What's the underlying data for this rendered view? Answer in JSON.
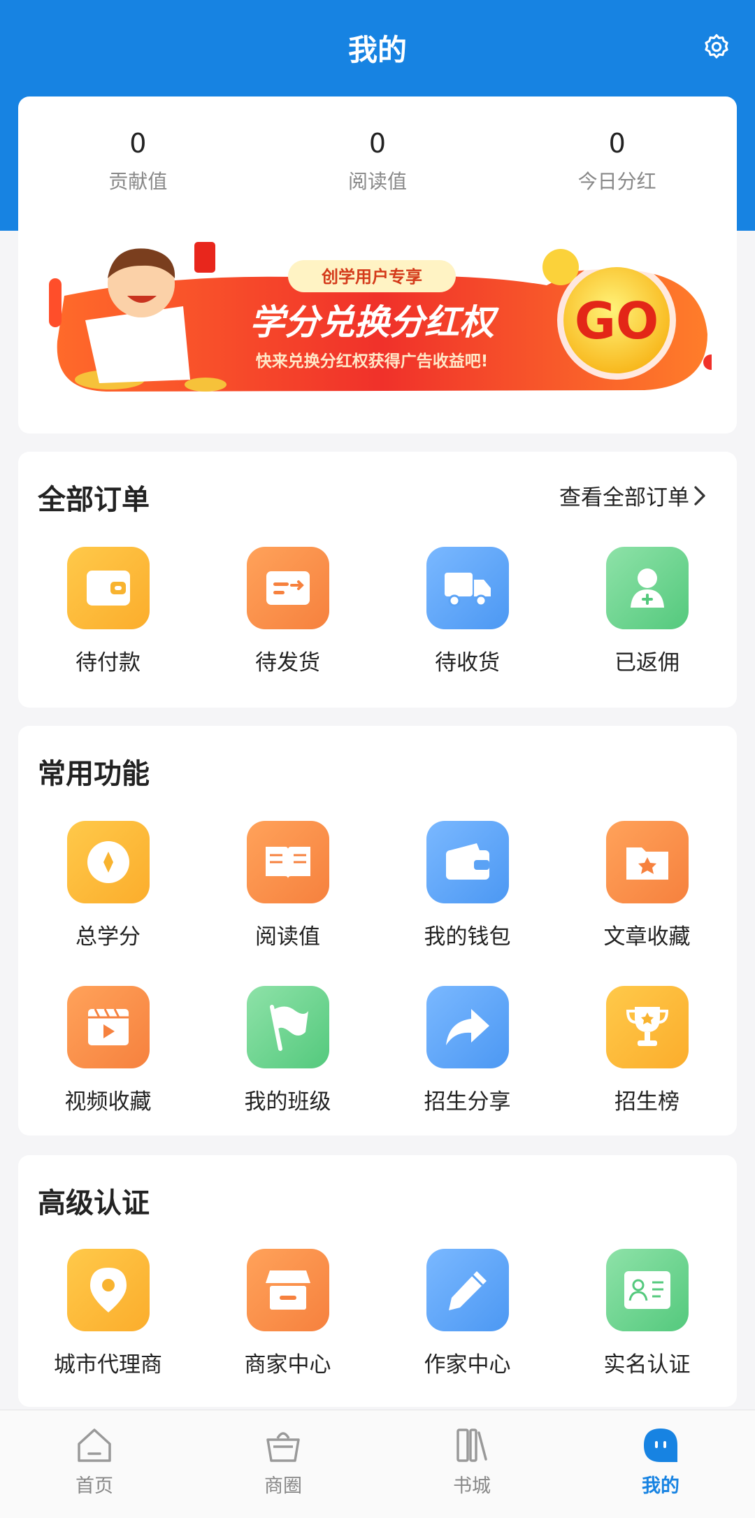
{
  "header": {
    "title": "我的"
  },
  "stats": [
    {
      "value": "0",
      "label": "贡献值"
    },
    {
      "value": "0",
      "label": "阅读值"
    },
    {
      "value": "0",
      "label": "今日分红"
    }
  ],
  "banner": {
    "tag": "创学用户专享",
    "title": "学分兑换分红权",
    "subtitle": "快来兑换分红权获得广告收益吧!",
    "cta": "GO"
  },
  "orders": {
    "title": "全部订单",
    "more": "查看全部订单",
    "items": [
      {
        "label": "待付款",
        "icon": "wallet-icon"
      },
      {
        "label": "待发货",
        "icon": "shipping-card-icon"
      },
      {
        "label": "待收货",
        "icon": "truck-icon"
      },
      {
        "label": "已返佣",
        "icon": "user-plus-icon"
      }
    ]
  },
  "common": {
    "title": "常用功能",
    "items": [
      {
        "label": "总学分",
        "icon": "coin-icon"
      },
      {
        "label": "阅读值",
        "icon": "book-icon"
      },
      {
        "label": "我的钱包",
        "icon": "wallet-icon"
      },
      {
        "label": "文章收藏",
        "icon": "folder-star-icon"
      },
      {
        "label": "视频收藏",
        "icon": "video-icon"
      },
      {
        "label": "我的班级",
        "icon": "flag-icon"
      },
      {
        "label": "招生分享",
        "icon": "share-icon"
      },
      {
        "label": "招生榜",
        "icon": "trophy-icon"
      }
    ]
  },
  "advanced": {
    "title": "高级认证",
    "items": [
      {
        "label": "城市代理商",
        "icon": "location-icon"
      },
      {
        "label": "商家中心",
        "icon": "shop-icon"
      },
      {
        "label": "作家中心",
        "icon": "pencil-icon"
      },
      {
        "label": "实名认证",
        "icon": "id-card-icon"
      }
    ]
  },
  "tabbar": [
    {
      "label": "首页",
      "icon": "home-icon"
    },
    {
      "label": "商圈",
      "icon": "basket-icon"
    },
    {
      "label": "书城",
      "icon": "books-icon"
    },
    {
      "label": "我的",
      "icon": "profile-icon"
    }
  ],
  "colors": {
    "primary": "#1783e2",
    "yellow": "#fbad2c",
    "orange": "#f6813e",
    "blue": "#4c98f3",
    "green": "#54c97d"
  }
}
